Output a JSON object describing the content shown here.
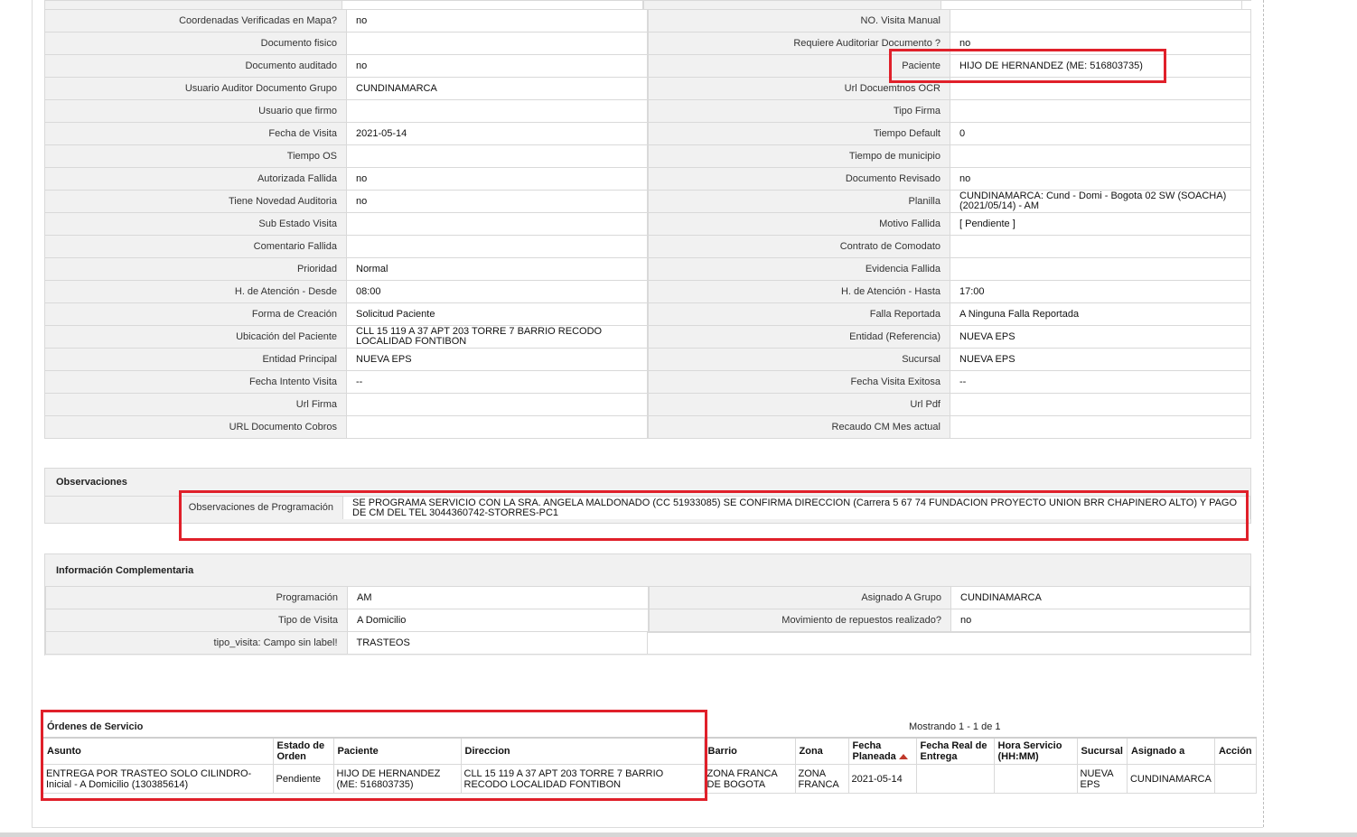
{
  "main_grid": [
    [
      "Coordenadas Verificadas en Mapa?",
      "no",
      "NO. Visita Manual",
      ""
    ],
    [
      "Documento fisico",
      "",
      "Requiere Auditoriar Documento ?",
      "no"
    ],
    [
      "Documento auditado",
      "no",
      "Paciente",
      "HIJO DE HERNANDEZ (ME: 516803735)"
    ],
    [
      "Usuario Auditor Documento Grupo",
      "CUNDINAMARCA",
      "Url Docuemtnos OCR",
      ""
    ],
    [
      "Usuario que firmo",
      "",
      "Tipo Firma",
      ""
    ],
    [
      "Fecha de Visita",
      "2021-05-14",
      "Tiempo Default",
      "0"
    ],
    [
      "Tiempo OS",
      "",
      "Tiempo de municipio",
      ""
    ],
    [
      "Autorizada Fallida",
      "no",
      "Documento Revisado",
      "no"
    ],
    [
      "Tiene Novedad Auditoria",
      "no",
      "Planilla",
      "CUNDINAMARCA: Cund - Domi - Bogota 02 SW (SOACHA) (2021/05/14) - AM"
    ],
    [
      "Sub Estado Visita",
      "",
      "Motivo Fallida",
      "[ Pendiente ]"
    ],
    [
      "Comentario Fallida",
      "",
      "Contrato de Comodato",
      ""
    ],
    [
      "Prioridad",
      "Normal",
      "Evidencia Fallida",
      ""
    ],
    [
      "H. de Atención - Desde",
      "08:00",
      "H. de Atención - Hasta",
      "17:00"
    ],
    [
      "Forma de Creación",
      "Solicitud Paciente",
      "Falla Reportada",
      "A Ninguna Falla Reportada"
    ],
    [
      "Ubicación del Paciente",
      "CLL 15 119 A 37 APT 203 TORRE 7 BARRIO RECODO LOCALIDAD FONTIBON",
      "Entidad (Referencia)",
      "NUEVA EPS"
    ],
    [
      "Entidad Principal",
      "NUEVA EPS",
      "Sucursal",
      "NUEVA EPS"
    ],
    [
      "Fecha Intento Visita",
      "--",
      "Fecha Visita Exitosa",
      "--"
    ],
    [
      "Url Firma",
      "",
      "Url Pdf",
      ""
    ],
    [
      "URL Documento Cobros",
      "",
      "Recaudo CM Mes actual",
      ""
    ]
  ],
  "observaciones": {
    "title": "Observaciones",
    "label": "Observaciones de Programación",
    "value": " SE PROGRAMA SERVICIO CON LA SRA. ANGELA MALDONADO (CC 51933085) SE CONFIRMA DIRECCION (Carrera 5 67 74 FUNDACION PROYECTO UNION BRR CHAPINERO ALTO) Y PAGO DE CM DEL TEL 3044360742-STORRES-PC1"
  },
  "info": {
    "title": "Información Complementaria",
    "rows": [
      [
        "Programación",
        "AM",
        "Asignado A Grupo",
        "CUNDINAMARCA"
      ],
      [
        "Tipo de Visita",
        "A Domicilio",
        "Movimiento de repuestos realizado?",
        "no"
      ],
      [
        "tipo_visita: Campo sin label!",
        "TRASTEOS",
        null,
        null
      ]
    ]
  },
  "orders": {
    "title": "Órdenes de Servicio",
    "count_text": "Mostrando 1 - 1 de 1",
    "headers": [
      "Asunto",
      "Estado de Orden",
      "Paciente",
      "Direccion",
      "Barrio",
      "Zona",
      "Fecha Planeada",
      "Fecha Real de Entrega",
      "Hora Servicio (HH:MM)",
      "Sucursal",
      "Asignado a",
      "Acción"
    ],
    "rows": [
      [
        "ENTREGA POR TRASTEO SOLO CILINDRO-Inicial - A Domicilio (130385614)",
        "Pendiente",
        "HIJO DE HERNANDEZ (ME: 516803735)",
        "CLL 15 119 A 37 APT 203 TORRE 7 BARRIO RECODO LOCALIDAD FONTIBON",
        "ZONA FRANCA DE BOGOTA",
        "ZONA FRANCA",
        "2021-05-14",
        "",
        "",
        "NUEVA EPS",
        "CUNDINAMARCA",
        ""
      ]
    ]
  },
  "colors": {
    "highlight": "#e0202a",
    "label_bg": "#f1f1f1",
    "border": "#d9d9d9"
  }
}
